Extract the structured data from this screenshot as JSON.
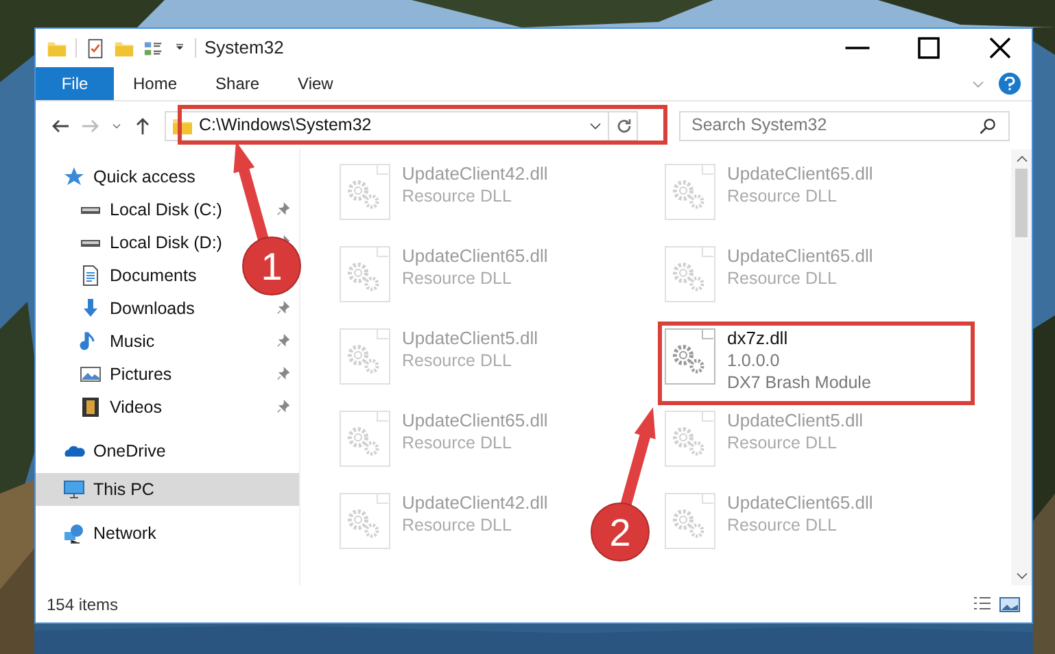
{
  "window": {
    "title": "System32"
  },
  "ribbon_tabs": [
    {
      "label": "File",
      "kind": "file"
    },
    {
      "label": "Home",
      "kind": "tab"
    },
    {
      "label": "Share",
      "kind": "tab"
    },
    {
      "label": "View",
      "kind": "tab"
    }
  ],
  "address_bar": {
    "path": "C:\\Windows\\System32"
  },
  "search": {
    "placeholder": "Search System32"
  },
  "navigation": [
    {
      "label": "Quick access",
      "selected": false,
      "children": [
        {
          "label": "Local Disk (C:)",
          "pinned": true,
          "selected": false
        },
        {
          "label": "Local Disk (D:)",
          "pinned": true,
          "selected": false
        },
        {
          "label": "Documents",
          "selected": false
        },
        {
          "label": "Downloads",
          "pinned": true,
          "selected": false
        },
        {
          "label": "Music",
          "pinned": true,
          "selected": false
        },
        {
          "label": "Pictures",
          "pinned": true,
          "selected": false
        },
        {
          "label": "Videos",
          "pinned": true,
          "selected": false
        }
      ]
    },
    {
      "label": "OneDrive",
      "selected": false
    },
    {
      "label": "This PC",
      "selected": true
    },
    {
      "label": "Network",
      "selected": false
    }
  ],
  "files": [
    {
      "name": "UpdateClient42.dll",
      "lines": [
        "Resource DLL"
      ],
      "dimmed": true
    },
    {
      "name": "UpdateClient65.dll",
      "lines": [
        "Resource DLL"
      ],
      "dimmed": true
    },
    {
      "name": "UpdateClient65.dll",
      "lines": [
        "Resource DLL"
      ],
      "dimmed": true
    },
    {
      "name": "UpdateClient65.dll",
      "lines": [
        "Resource DLL"
      ],
      "dimmed": true
    },
    {
      "name": "UpdateClient5.dll",
      "lines": [
        "Resource DLL"
      ],
      "dimmed": true
    },
    {
      "name": "dx7z.dll",
      "lines": [
        "1.0.0.0",
        "DX7 Brash Module"
      ],
      "dimmed": false
    },
    {
      "name": "UpdateClient65.dll",
      "lines": [
        "Resource DLL"
      ],
      "dimmed": true
    },
    {
      "name": "UpdateClient5.dll",
      "lines": [
        "Resource DLL"
      ],
      "dimmed": true
    },
    {
      "name": "UpdateClient42.dll",
      "lines": [
        "Resource DLL"
      ],
      "dimmed": true
    },
    {
      "name": "UpdateClient65.dll",
      "lines": [
        "Resource DLL"
      ],
      "dimmed": true
    }
  ],
  "status_bar": {
    "item_count": "154 items"
  },
  "annotations": [
    {
      "number": "1"
    },
    {
      "number": "2"
    }
  ]
}
